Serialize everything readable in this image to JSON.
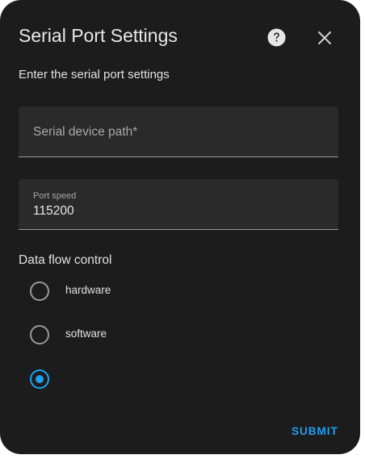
{
  "dialog": {
    "title": "Serial Port Settings",
    "description": "Enter the serial port settings",
    "help_icon": "help-circle-icon",
    "close_icon": "close-icon"
  },
  "fields": {
    "device_path": {
      "label": "Serial device path*",
      "value": ""
    },
    "port_speed": {
      "label": "Port speed",
      "value": "115200"
    }
  },
  "flow_control": {
    "title": "Data flow control",
    "options": [
      {
        "label": "hardware",
        "checked": false
      },
      {
        "label": "software",
        "checked": false
      },
      {
        "label": "",
        "checked": true
      }
    ]
  },
  "actions": {
    "submit_label": "SUBMIT"
  },
  "colors": {
    "accent": "#1ea0f2",
    "background": "#1c1c1c",
    "field_background": "#2a2a2a"
  }
}
